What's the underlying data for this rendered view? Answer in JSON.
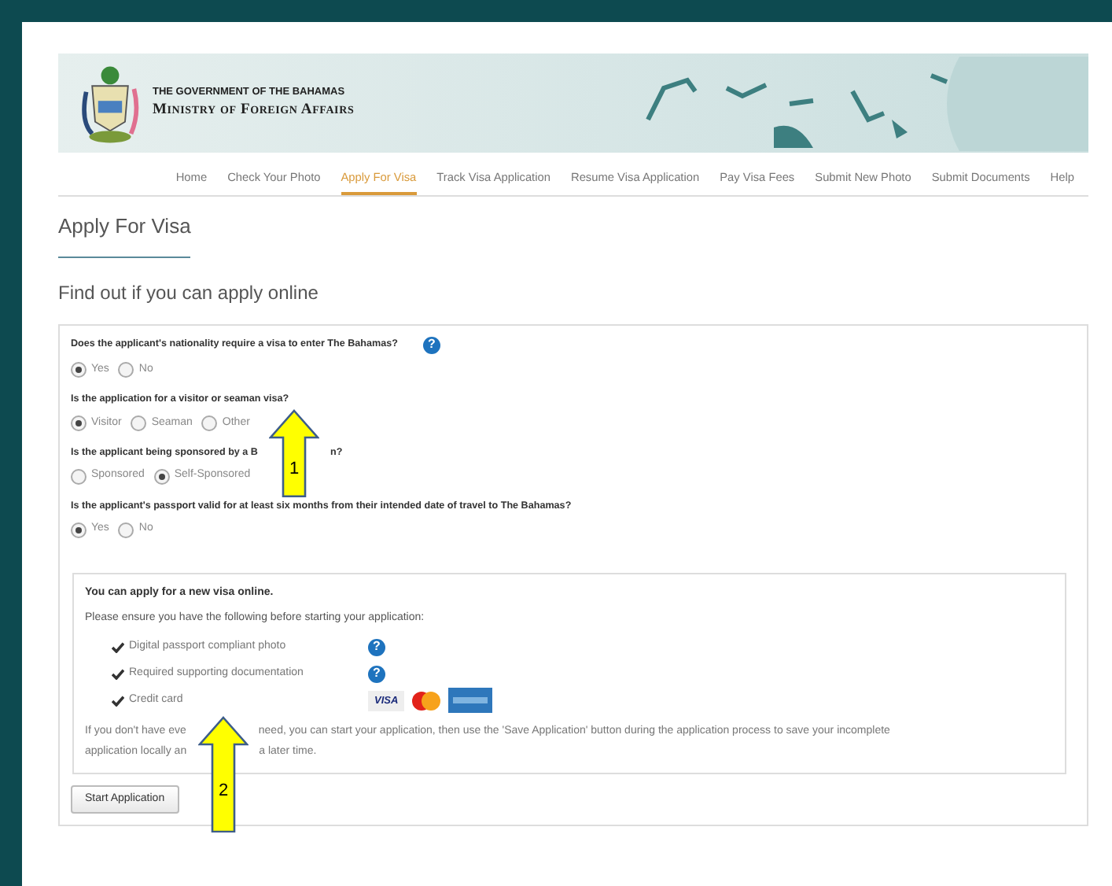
{
  "header": {
    "line_1": "THE GOVERNMENT OF THE BAHAMAS",
    "line_2": "Ministry of Foreign Affairs"
  },
  "nav": [
    {
      "label": "Home",
      "selected": false
    },
    {
      "label": "Check Your Photo",
      "selected": false
    },
    {
      "label": "Apply For Visa",
      "selected": true
    },
    {
      "label": "Track Visa Application",
      "selected": false
    },
    {
      "label": "Resume Visa Application",
      "selected": false
    },
    {
      "label": "Pay Visa Fees",
      "selected": false
    },
    {
      "label": "Submit New Photo",
      "selected": false
    },
    {
      "label": "Submit Documents",
      "selected": false
    },
    {
      "label": "Help",
      "selected": false
    }
  ],
  "page_title": "Apply For Visa",
  "section_title": "Find out if you can apply online",
  "questions": [
    {
      "text": "Does the applicant's nationality require a visa to enter The Bahamas?",
      "help": "?",
      "options": [
        {
          "label": "Yes",
          "selected": true
        },
        {
          "label": "No",
          "selected": false
        }
      ]
    },
    {
      "text": "Is the application for a visitor or seaman visa?",
      "options": [
        {
          "label": "Visitor",
          "selected": true
        },
        {
          "label": "Seaman",
          "selected": false
        },
        {
          "label": "Other",
          "selected": false
        }
      ]
    },
    {
      "text": "Is the applicant being sponsored by a B",
      "text_after": "n?",
      "options": [
        {
          "label": "Sponsored",
          "selected": false
        },
        {
          "label": "Self-Sponsored",
          "selected": true
        }
      ]
    },
    {
      "text": "Is the applicant's passport valid for at least six months from their intended date of travel to The Bahamas?",
      "options": [
        {
          "label": "Yes",
          "selected": true
        },
        {
          "label": "No",
          "selected": false
        }
      ]
    }
  ],
  "result": {
    "title": "You can apply for a new visa online.",
    "intro": "Please ensure you have the following before starting your application:",
    "requirements": [
      {
        "label": "Digital passport compliant photo",
        "help": "?"
      },
      {
        "label": "Required supporting documentation",
        "help": "?"
      },
      {
        "label": "Credit card",
        "cards": [
          {
            "kind": "visa",
            "label": "VISA"
          },
          {
            "kind": "mastercard"
          },
          {
            "kind": "amex"
          }
        ]
      }
    ],
    "note_lines": [
      [
        "If you don't have eve",
        "need, you can start your application, then use the 'Save Application' button during the application process to save your incomplete"
      ],
      [
        "application locally an",
        "a later time."
      ]
    ]
  },
  "start_button": "Start Application",
  "callouts": [
    {
      "number": "1"
    },
    {
      "number": "2"
    }
  ]
}
